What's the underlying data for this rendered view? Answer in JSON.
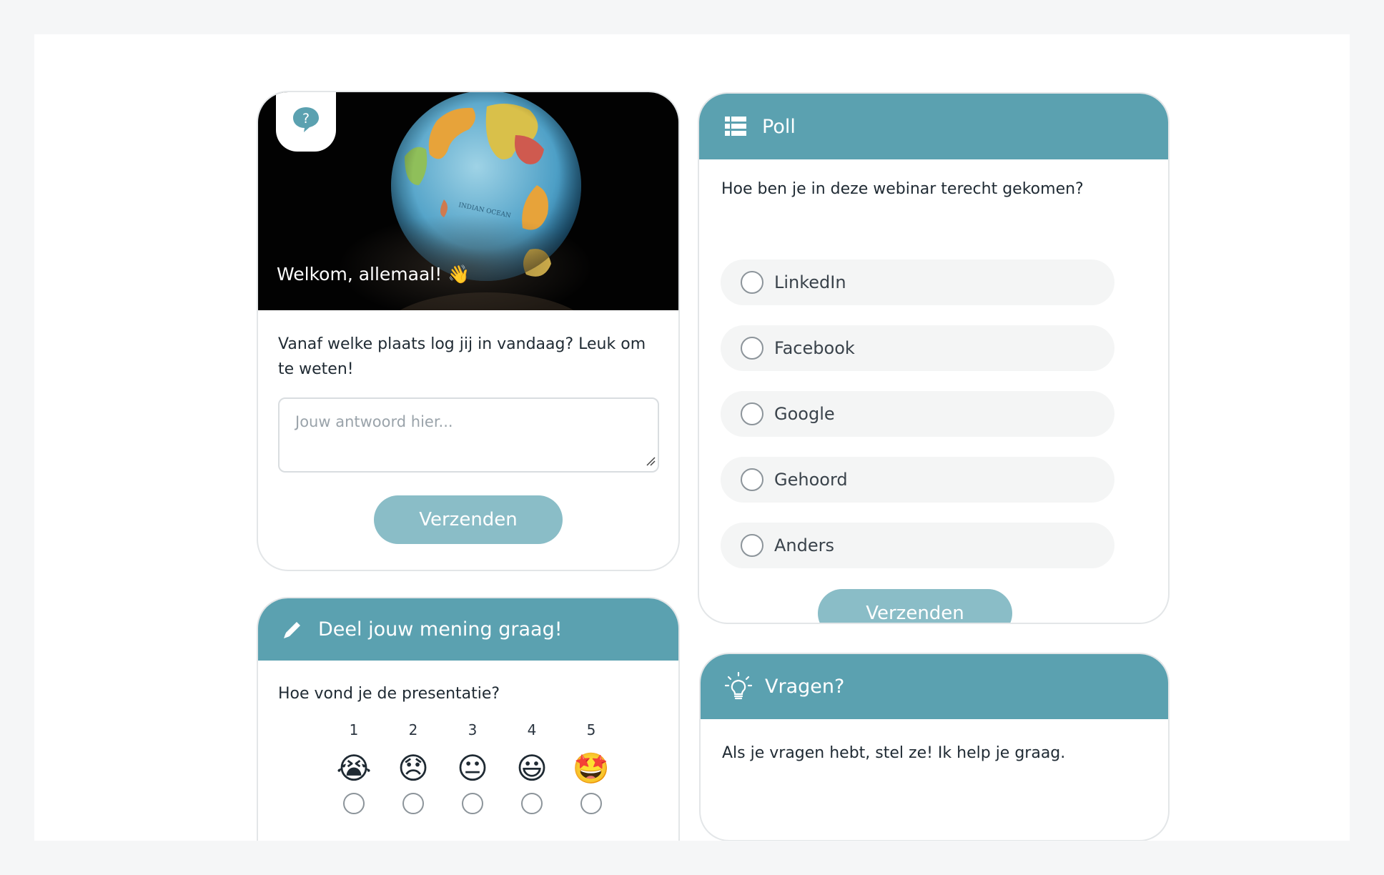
{
  "welcome_card": {
    "title": "Welkom, allemaal! 👋",
    "badge_icon": "question-bubble-icon",
    "question": "Vanaf welke plaats log jij in vandaag? Leuk om te weten!",
    "answer_placeholder": "Jouw antwoord hier...",
    "submit_label": "Verzenden"
  },
  "opinion_card": {
    "header_icon": "pencil-icon",
    "title": "Deel jouw mening graag!",
    "question": "Hoe vond je de presentatie?",
    "ratings": [
      {
        "number": "1",
        "emoji": "😭"
      },
      {
        "number": "2",
        "emoji": "😞"
      },
      {
        "number": "3",
        "emoji": "😐"
      },
      {
        "number": "4",
        "emoji": "😃"
      },
      {
        "number": "5",
        "emoji": "🤩"
      }
    ]
  },
  "poll_card": {
    "header_icon": "list-icon",
    "title": "Poll",
    "question": "Hoe ben je in deze webinar terecht gekomen?",
    "options": [
      "LinkedIn",
      "Facebook",
      "Google",
      "Gehoord",
      "Anders"
    ],
    "submit_label": "Verzenden"
  },
  "questions_card": {
    "header_icon": "lightbulb-icon",
    "title": "Vragen?",
    "text": "Als je vragen hebt, stel ze! Ik help je graag."
  },
  "colors": {
    "accent": "#5ba1b0",
    "button": "#8abdc7",
    "background": "#f5f6f7"
  }
}
